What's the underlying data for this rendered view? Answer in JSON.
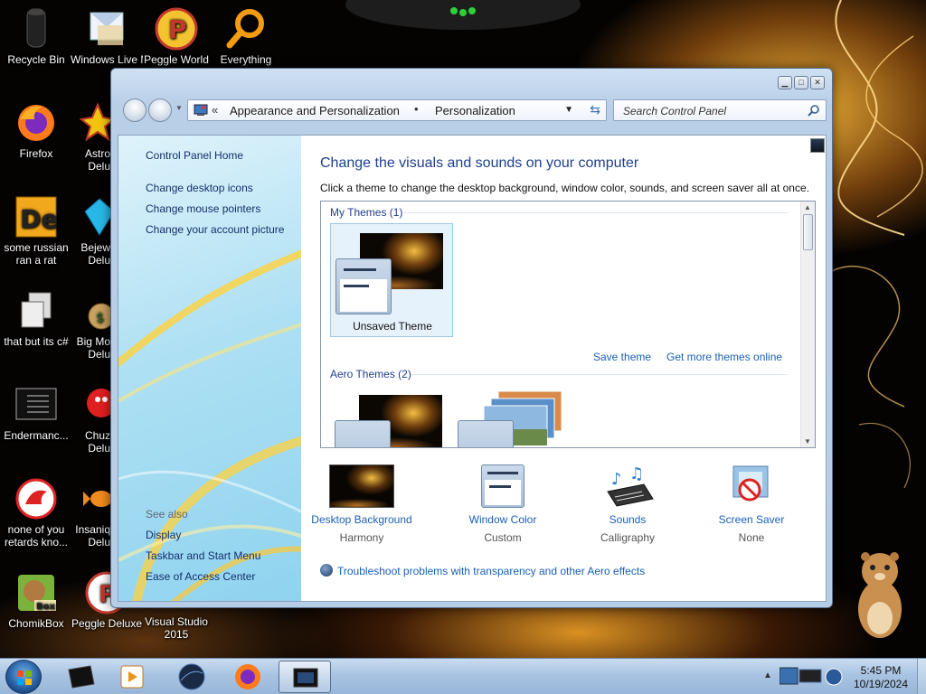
{
  "desktop": {
    "icons": [
      {
        "label": "Recycle Bin",
        "icon": "recycle-bin-icon"
      },
      {
        "label": "Windows Live Mail",
        "icon": "mail-icon"
      },
      {
        "label": "Peggle World",
        "icon": "peggle-icon"
      },
      {
        "label": "Everything",
        "icon": "magnifier-icon"
      },
      {
        "label": "Firefox",
        "icon": "firefox-icon"
      },
      {
        "label": "Astro Delu",
        "icon": "astro-icon"
      },
      {
        "label": "some russian ran a rat",
        "icon": "de-icon"
      },
      {
        "label": "Bejew Delu",
        "icon": "gem-icon"
      },
      {
        "label": "that but its c#",
        "icon": "copy-icon"
      },
      {
        "label": "Big Mo Delu",
        "icon": "moneybag-icon"
      },
      {
        "label": "Endermanc...",
        "icon": "console-icon"
      },
      {
        "label": "Chuz Delu",
        "icon": "chuzzle-icon"
      },
      {
        "label": "none of you retards kno...",
        "icon": "dragon-icon"
      },
      {
        "label": "Insaniq Delu",
        "icon": "fish-icon"
      },
      {
        "label": "ChomikBox",
        "icon": "hamster-box-icon"
      },
      {
        "label": "Peggle Deluxe",
        "icon": "peggle-deluxe-icon"
      },
      {
        "label": "Visual Studio 2015",
        "icon": "visual-studio-icon"
      }
    ]
  },
  "window": {
    "controls": {
      "minimize": "▁",
      "maximize": "□",
      "close": "✕"
    },
    "address": {
      "chevron": "«",
      "crumbs": [
        "Appearance and Personalization",
        "Personalization"
      ],
      "separator": "•"
    },
    "search": {
      "placeholder": "Search Control Panel"
    },
    "sidebar": {
      "links": [
        "Control Panel Home",
        "Change desktop icons",
        "Change mouse pointers",
        "Change your account picture"
      ],
      "see_also_label": "See also",
      "see_also": [
        "Display",
        "Taskbar and Start Menu",
        "Ease of Access Center"
      ]
    },
    "main": {
      "title": "Change the visuals and sounds on your computer",
      "description": "Click a theme to change the desktop background, window color, sounds, and screen saver all at once.",
      "groups": {
        "my_themes": {
          "header": "My Themes (1)",
          "tiles": [
            {
              "caption": "Unsaved Theme",
              "selected": true
            }
          ]
        },
        "aero_themes": {
          "header": "Aero Themes (2)"
        }
      },
      "links": {
        "save_theme": "Save theme",
        "get_more": "Get more themes online"
      },
      "scroll_position": 0.0,
      "bottom_items": [
        {
          "label": "Desktop Background",
          "value": "Harmony",
          "icon": "desktop-background-icon"
        },
        {
          "label": "Window Color",
          "value": "Custom",
          "icon": "window-color-icon"
        },
        {
          "label": "Sounds",
          "value": "Calligraphy",
          "icon": "sounds-icon"
        },
        {
          "label": "Screen Saver",
          "value": "None",
          "icon": "screen-saver-icon"
        }
      ],
      "troubleshoot": "Troubleshoot problems with transparency and other Aero effects"
    }
  },
  "taskbar": {
    "items": [
      "start-orb",
      "terminal-app",
      "media-player",
      "app-circle",
      "firefox",
      "control-panel-window"
    ],
    "time": "5:45 PM",
    "date": "10/19/2024"
  },
  "colors": {
    "accent": "#1e3f8a",
    "link": "#1a5fb4",
    "taskbar": "#a9c4e2"
  }
}
